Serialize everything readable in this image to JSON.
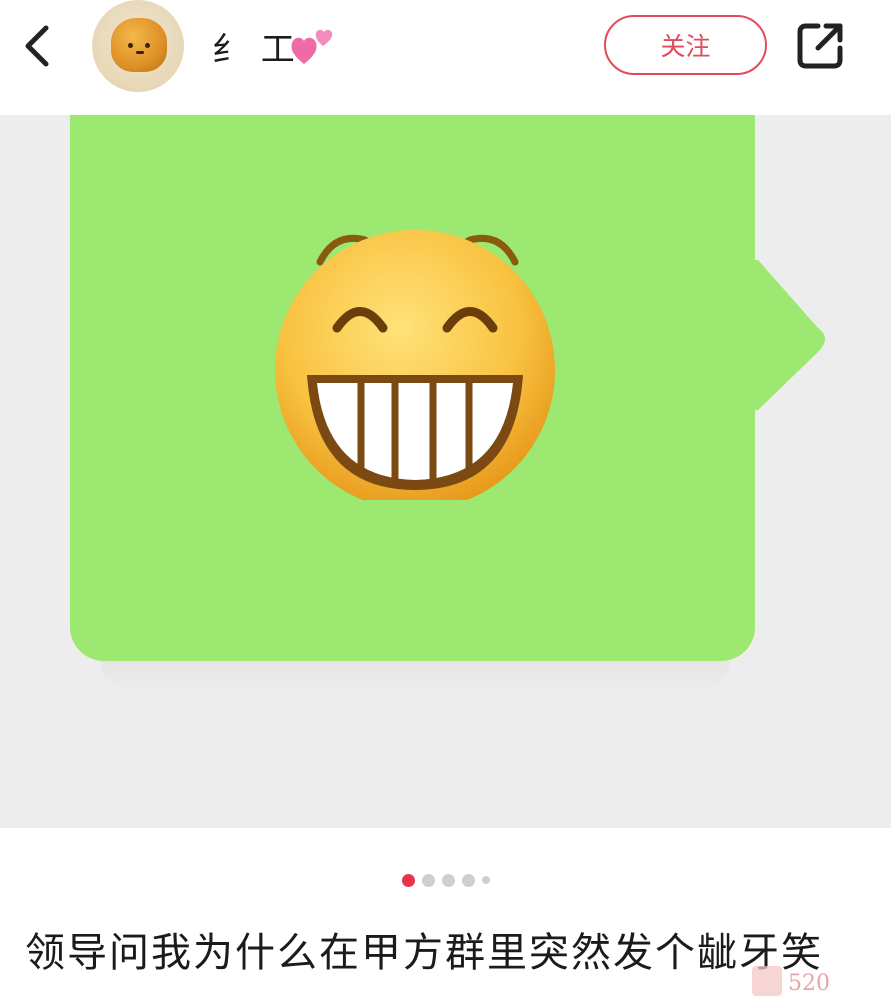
{
  "header": {
    "username": "纟 工",
    "follow_label": "关注",
    "icons": {
      "back": "chevron-left-icon",
      "avatar": "avatar",
      "heart": "two-hearts-icon",
      "share": "share-external-icon"
    }
  },
  "post": {
    "image": {
      "bubble_color": "#9ce870",
      "emoji": "grinning-face-emoji",
      "background": "#ededed"
    },
    "pager": {
      "count": 5,
      "active_index": 0,
      "active_color": "#e7344a"
    },
    "caption": "领导问我为什么在甲方群里突然发个龇牙笑"
  },
  "watermark": {
    "text": "520"
  }
}
